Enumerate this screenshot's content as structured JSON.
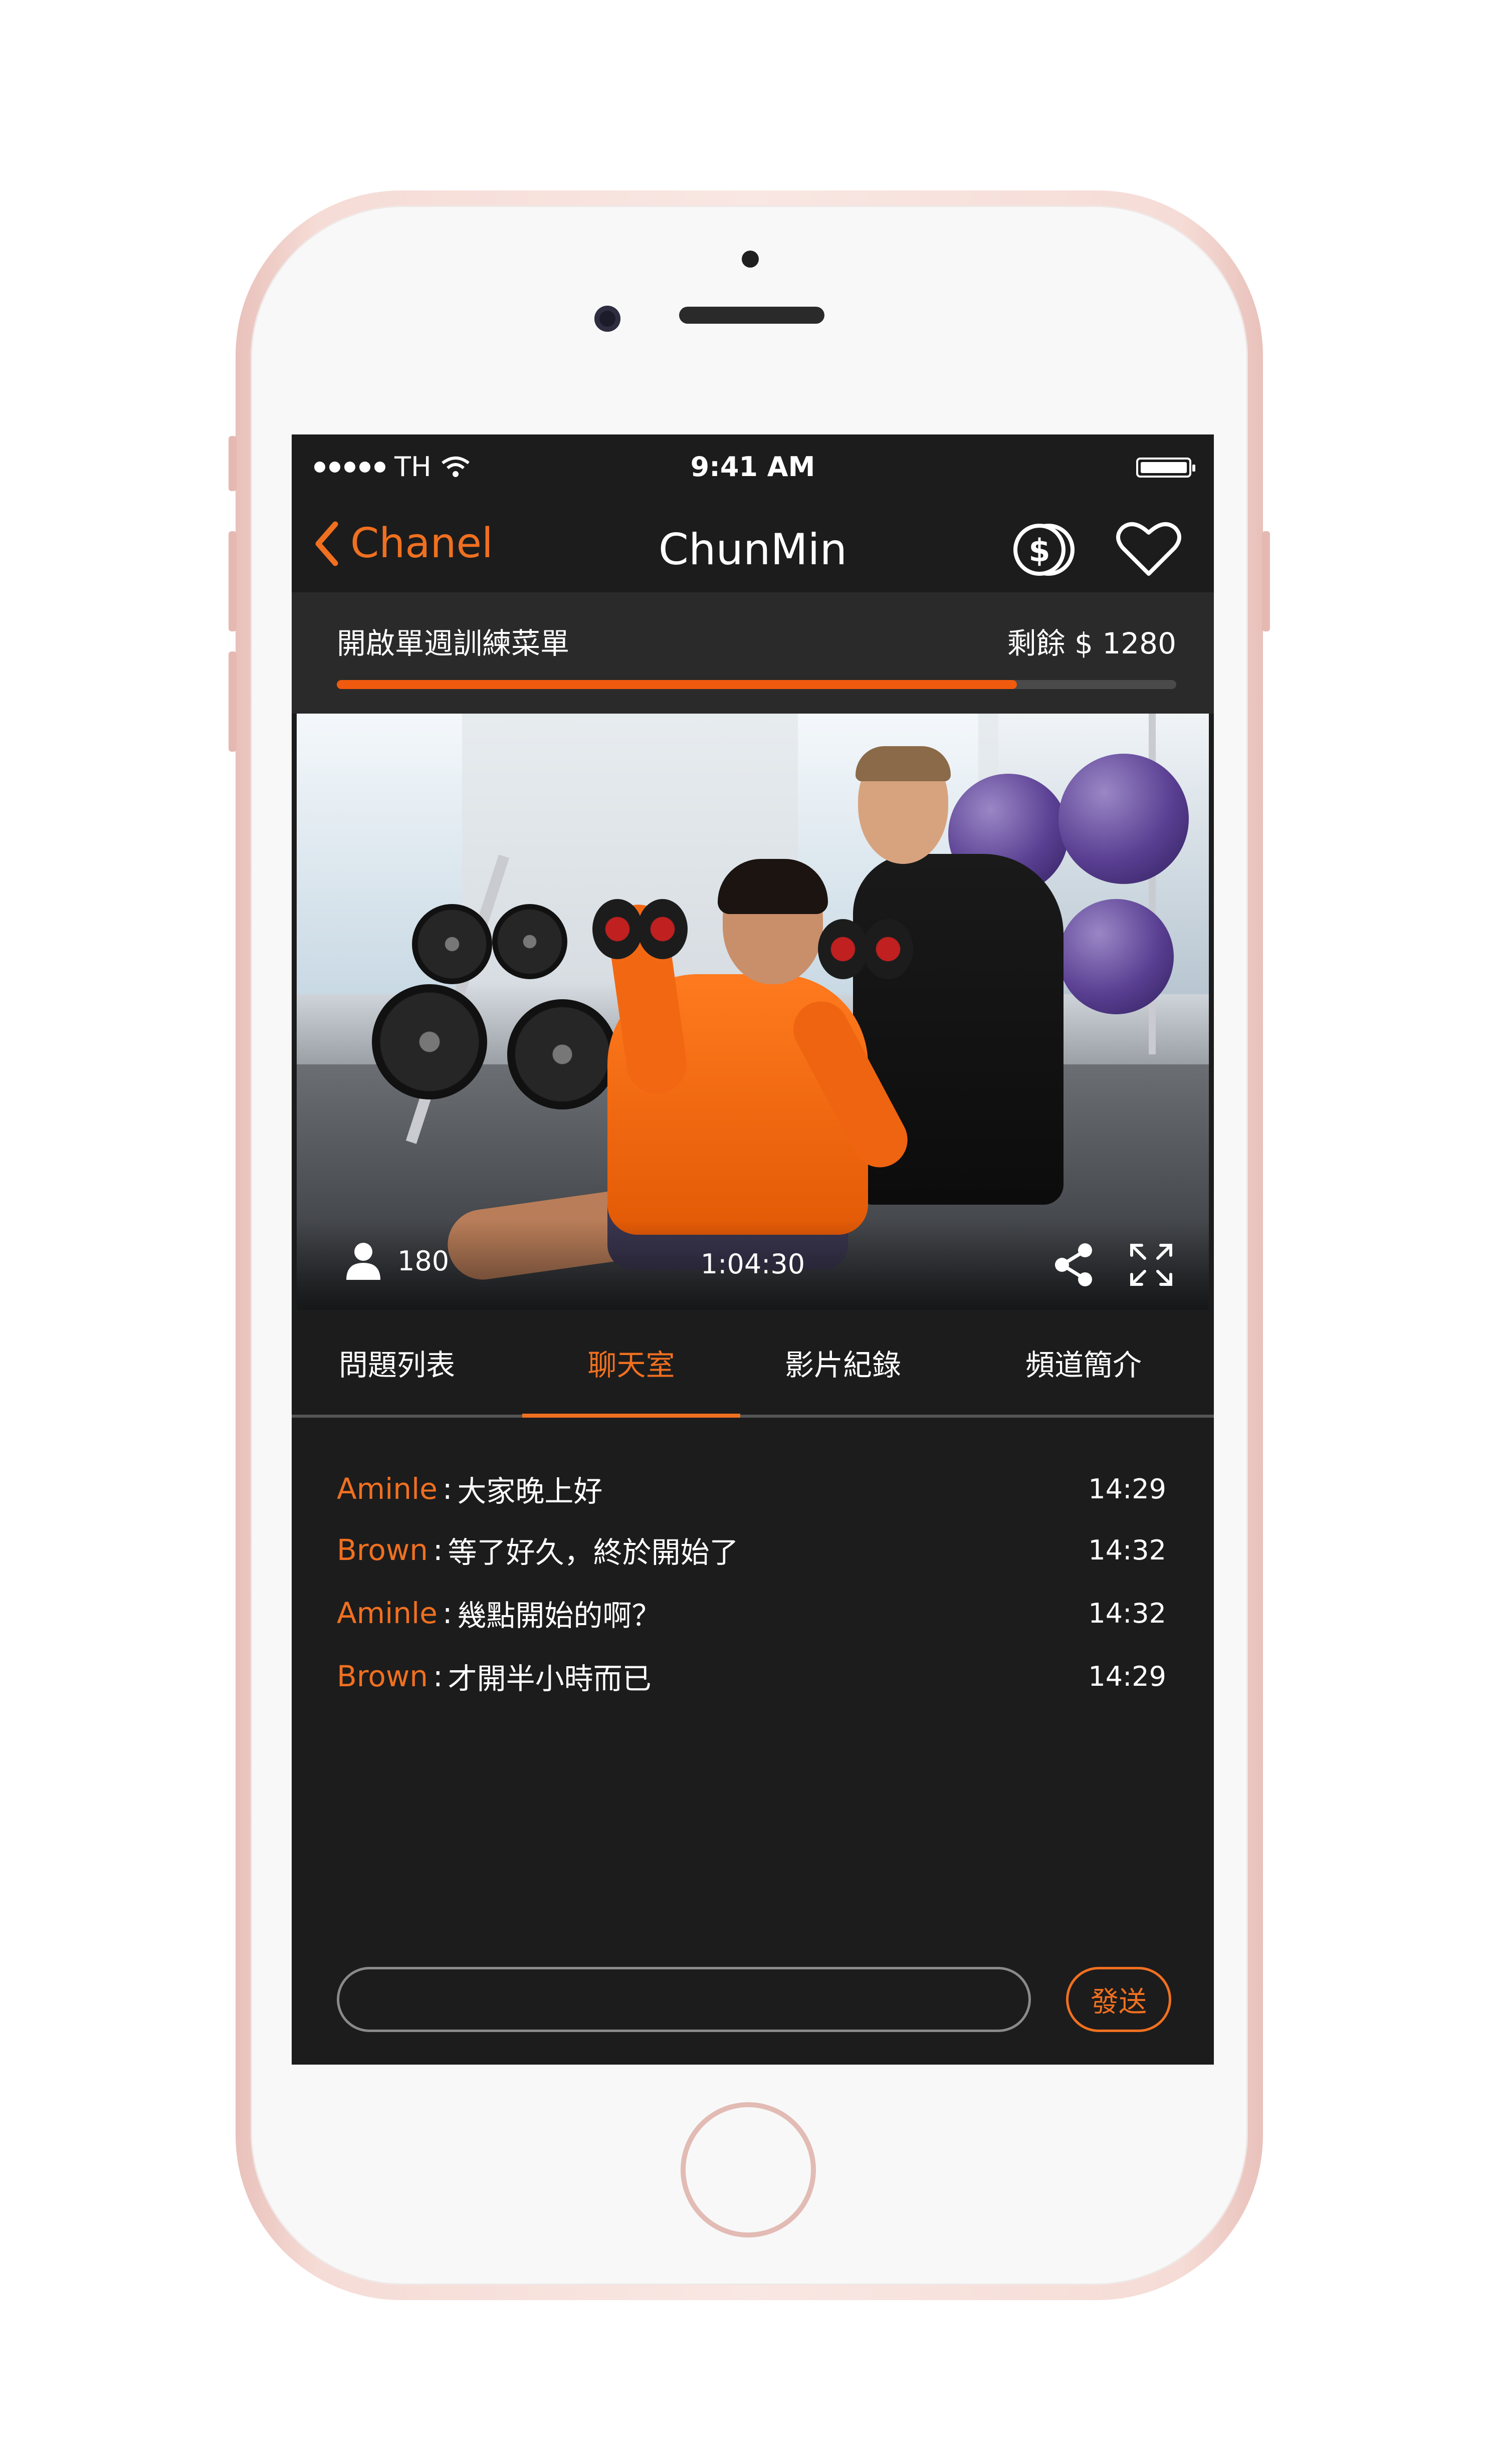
{
  "status_bar": {
    "carrier": "TH",
    "time": "9:41 AM"
  },
  "nav": {
    "back_label": "Chanel",
    "title": "ChunMin",
    "icons": [
      "chevron-left-icon",
      "dollar-coin-icon",
      "heart-icon"
    ]
  },
  "plan": {
    "title": "開啟單週訓練菜單",
    "remaining": "剩餘 $ 1280",
    "progress": 0.81
  },
  "video": {
    "viewers": "180",
    "duration": "1:04:30",
    "icons": [
      "person-icon",
      "share-icon",
      "fullscreen-icon"
    ]
  },
  "tabs": [
    {
      "label": "問題列表",
      "active": false
    },
    {
      "label": "聊天室",
      "active": true
    },
    {
      "label": "影片紀錄",
      "active": false
    },
    {
      "label": "頻道簡介",
      "active": false
    }
  ],
  "chat": [
    {
      "user": "Aminle",
      "sep": ":",
      "text": "大家晚上好",
      "time": "14:29"
    },
    {
      "user": "Brown",
      "sep": ":",
      "text": "等了好久，終於開始了",
      "time": "14:32"
    },
    {
      "user": "Aminle",
      "sep": ":",
      "text": "幾點開始的啊？",
      "time": "14:32"
    },
    {
      "user": "Brown",
      "sep": ":",
      "text": "才開半小時而已",
      "time": "14:29"
    }
  ],
  "composer": {
    "placeholder": "",
    "send_label": "發送"
  },
  "colors": {
    "accent": "#f07020",
    "background": "#1c1c1c",
    "panel": "#2a2a2a"
  }
}
